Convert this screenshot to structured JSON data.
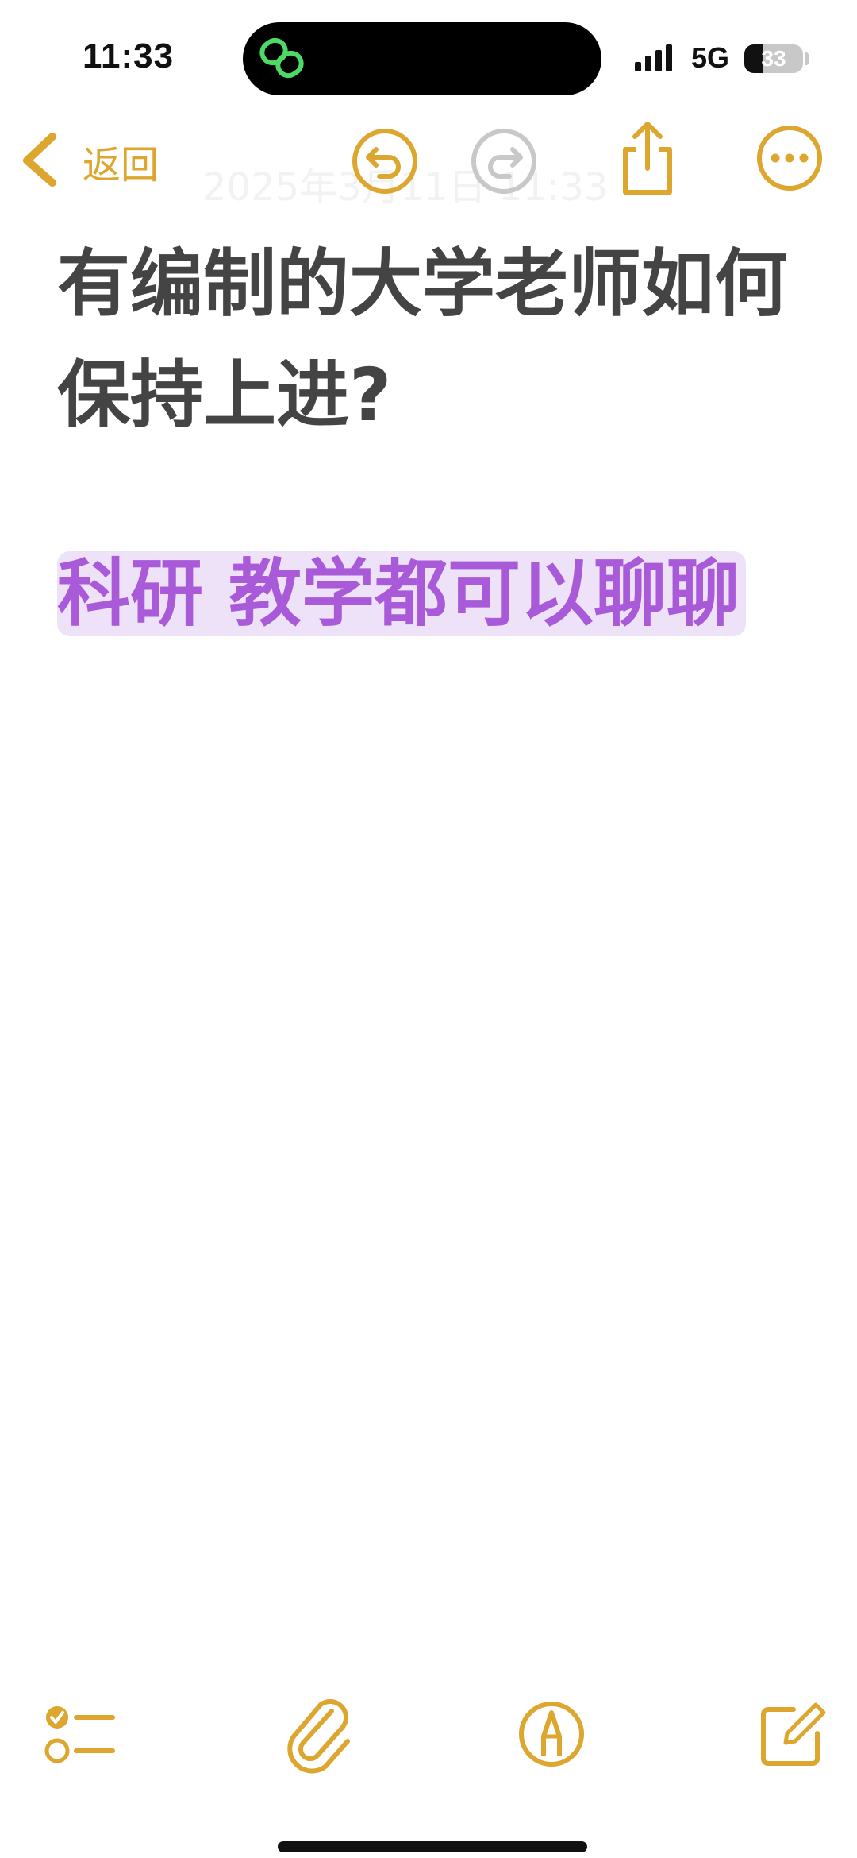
{
  "status_bar": {
    "time": "11:33",
    "network": "5G",
    "battery": "33",
    "battery_level": 0.33
  },
  "nav": {
    "back_label": "返回",
    "ghost_date": "2025年3月11日 11:33",
    "icons": [
      "back-chevron-icon",
      "undo-icon",
      "redo-icon",
      "share-icon",
      "more-icon"
    ]
  },
  "note": {
    "title": "有编制的大学老师如何保持上进?",
    "highlight": "科研 教学都可以聊聊"
  },
  "toolbar": {
    "icons": [
      "checklist-icon",
      "attachment-icon",
      "markup-icon",
      "compose-icon"
    ]
  },
  "colors": {
    "accent": "#dca62f",
    "title_text": "#444444",
    "highlight_text": "#a85ad8",
    "highlight_bg": "#ede2f8"
  }
}
